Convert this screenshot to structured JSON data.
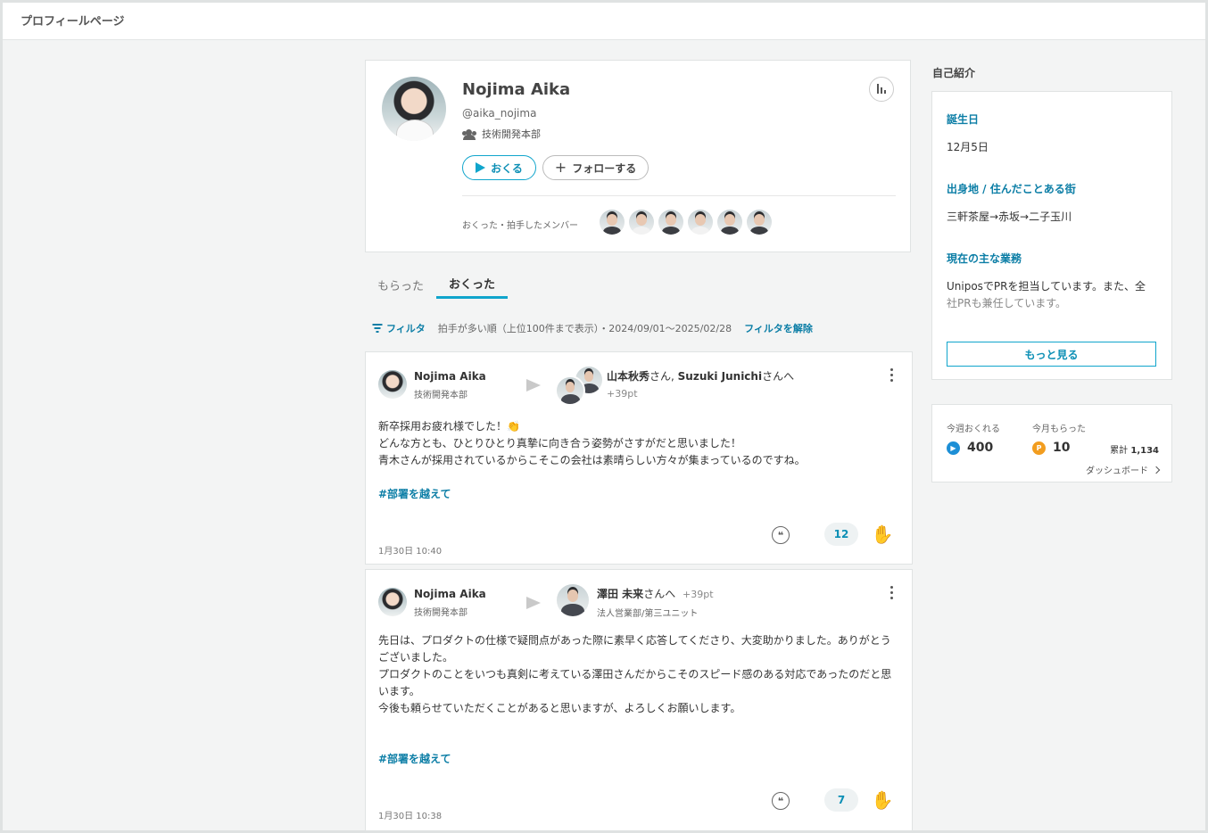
{
  "page": {
    "title": "プロフィールページ"
  },
  "profile": {
    "name": "Nojima Aika",
    "handle": "@aika_nojima",
    "department": "技術開発本部",
    "send_label": "おくる",
    "follow_label": "フォローする",
    "members_label": "おくった・拍手したメンバー",
    "member_count": 6
  },
  "tabs": [
    {
      "label": "もらった",
      "active": false
    },
    {
      "label": "おくった",
      "active": true
    }
  ],
  "filter": {
    "label": "フィルタ",
    "description": "拍手が多い順（上位100件まで表示）・2024/09/01〜2025/02/28",
    "clear_label": "フィルタを解除"
  },
  "posts": [
    {
      "sender_name": "Nojima Aika",
      "sender_dept": "技術開発本部",
      "recipient_name_1": "山本秋秀",
      "recipient_suffix_1": "さん, ",
      "recipient_name_2": "Suzuki Junichi",
      "recipient_suffix_2": "さんへ",
      "points": "+39pt",
      "body": [
        "新卒採用お疲れ様でした！👏",
        "どんな方とも、ひとりひとり真摯に向き合う姿勢がさすがだと思いました！",
        "青木さんが採用されているからこそこの会社は素晴らしい方々が集まっているのですね。"
      ],
      "hashtag": "#部署を越えて",
      "quote_icon": "quote-icon",
      "clap_count": "12",
      "clap_icon": "clap-icon",
      "time": "1月30日 10:40"
    },
    {
      "sender_name": "Nojima Aika",
      "sender_dept": "技術開発本部",
      "recipient_name": "澤田 未来",
      "recipient_suffix": "さんへ",
      "points": "+39pt",
      "recipient_dept": "法人営業部/第三ユニット",
      "body": [
        "先日は、プロダクトの仕様で疑問点があった際に素早く応答してくださり、大変助かりました。ありがとうございました。",
        "プロダクトのことをいつも真剣に考えている澤田さんだからこそのスピード感のある対応であったのだと思います。",
        "今後も頼らせていただくことがあると思いますが、よろしくお願いします。"
      ],
      "hashtag": "#部署を越えて",
      "clap_count": "7",
      "time": "1月30日 10:38"
    }
  ],
  "intro": {
    "title": "自己紹介",
    "birthday_label": "誕生日",
    "birthday": "12月5日",
    "hometown_label": "出身地 / 住んだことある街",
    "hometown": "三軒茶屋→赤坂→二子玉川",
    "work_label": "現在の主な業務",
    "work_line1": "UniposでPRを担当しています。また、全",
    "work_line2": "社PRも兼任しています。",
    "more_label": "もっと見る"
  },
  "points": {
    "sent_label": "今週おくれる",
    "sent_value": "400",
    "received_label": "今月もらった",
    "received_value": "10",
    "total_label": "累計",
    "total_value": "1,134",
    "dashboard_label": "ダッシュボード"
  },
  "colors": {
    "accent": "#10a5cc",
    "link": "#0c7ea6"
  }
}
